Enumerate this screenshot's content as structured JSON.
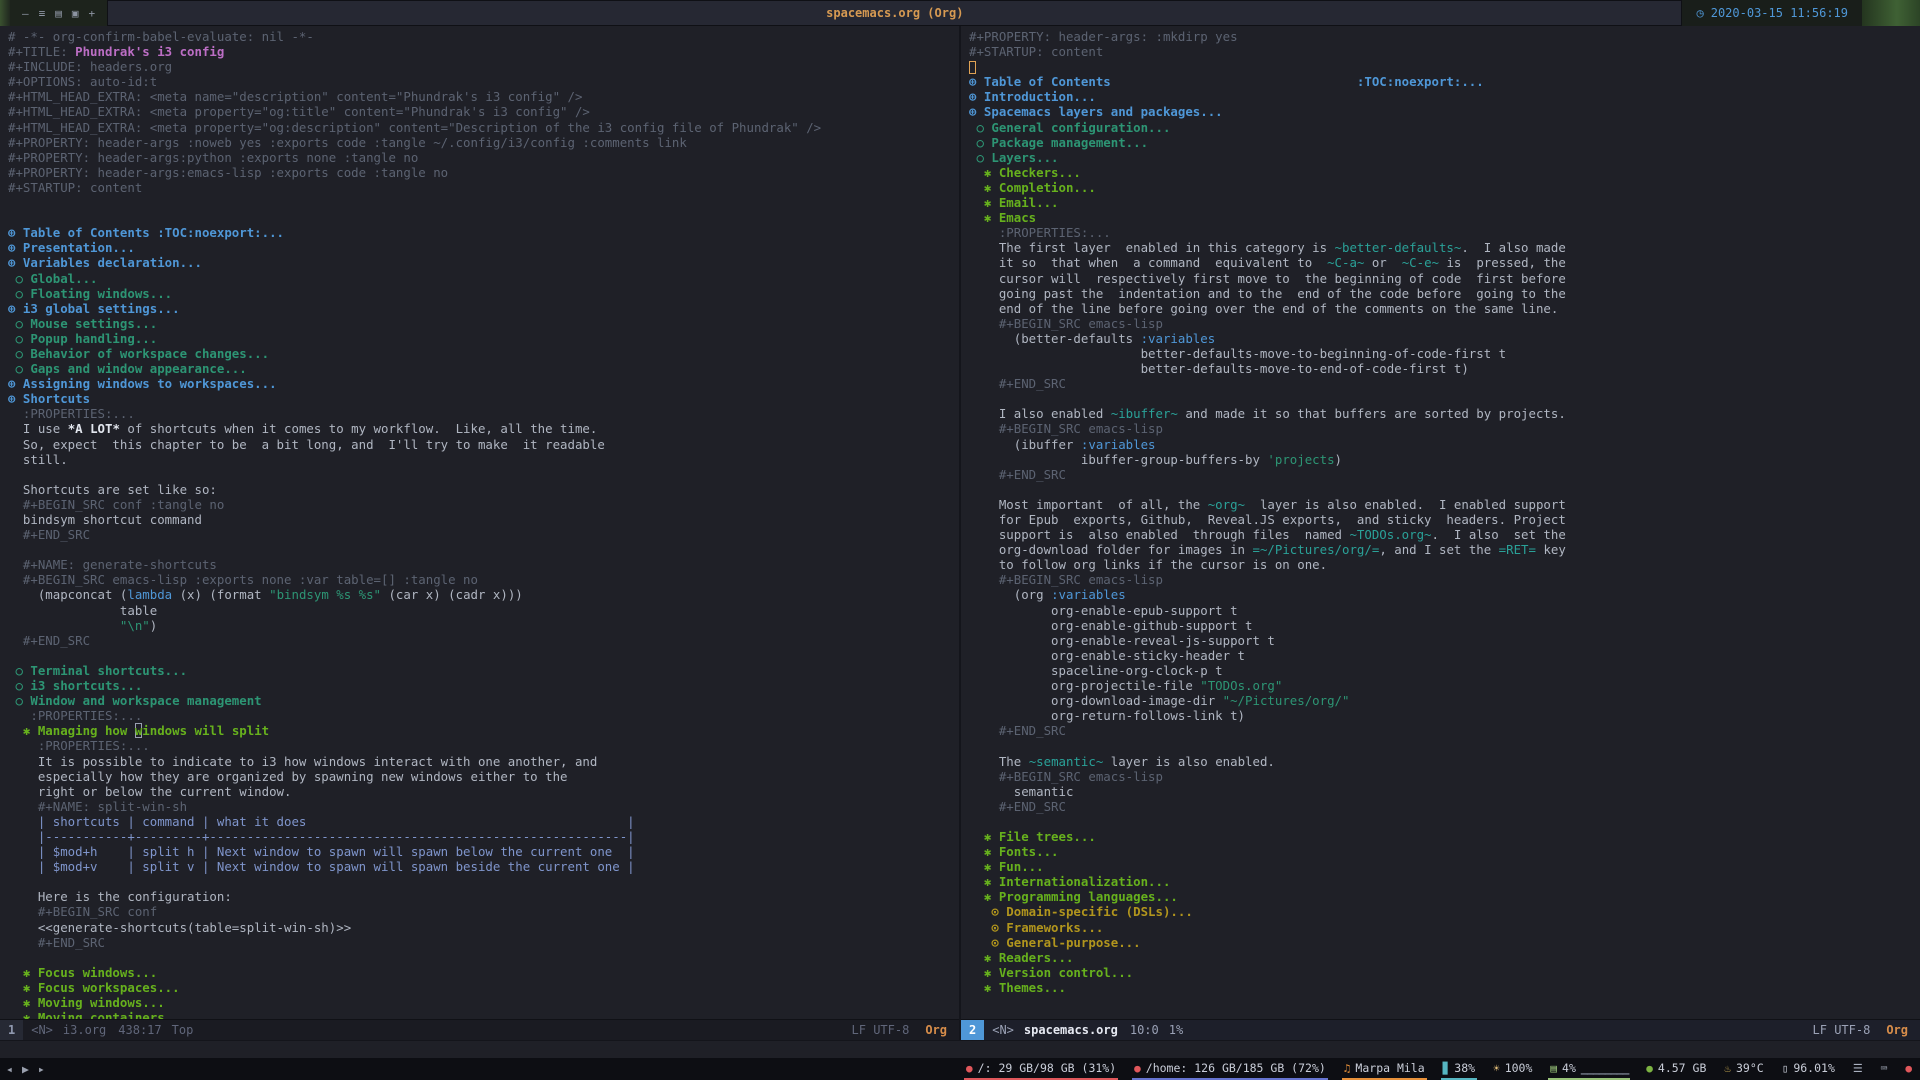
{
  "titlebar": {
    "window_icons": [
      "—",
      "≡",
      "▤",
      "▣",
      "+"
    ],
    "title": "spacemacs.org (Org)",
    "clock_icon": "◷",
    "datetime": "2020-03-15 11:56:19"
  },
  "left_modeline": {
    "win": "1",
    "state": "<N>",
    "buffer": "i3.org",
    "position": "438:17",
    "scroll": "Top",
    "encoding": "LF UTF-8",
    "mode": "Org"
  },
  "right_modeline": {
    "win": "2",
    "state": "<N>",
    "buffer": "spacemacs.org",
    "position": "10:0",
    "scroll": "1%",
    "encoding": "LF UTF-8",
    "mode": "Org"
  },
  "left_buffer": {
    "lines": [
      [
        [
          "c",
          "# -*- org-confirm-babel-evaluate: nil -*-"
        ]
      ],
      [
        [
          "c",
          "#+TITLE: "
        ],
        [
          "t",
          "Phundrak's i3 config"
        ]
      ],
      [
        [
          "c",
          "#+INCLUDE: headers.org"
        ]
      ],
      [
        [
          "c",
          "#+OPTIONS: auto-id:t"
        ]
      ],
      [
        [
          "c",
          "#+HTML_HEAD_EXTRA: <meta name=\"description\" content=\"Phundrak's i3 config\" />"
        ]
      ],
      [
        [
          "c",
          "#+HTML_HEAD_EXTRA: <meta property=\"og:title\" content=\"Phundrak's i3 config\" />"
        ]
      ],
      [
        [
          "c",
          "#+HTML_HEAD_EXTRA: <meta property=\"og:description\" content=\"Description of the i3 config file of Phundrak\" />"
        ]
      ],
      [
        [
          "c",
          "#+PROPERTY: header-args :noweb yes :exports code :tangle ~/.config/i3/config :comments link"
        ]
      ],
      [
        [
          "c",
          "#+PROPERTY: header-args:python :exports none :tangle no"
        ]
      ],
      [
        [
          "c",
          "#+PROPERTY: header-args:emacs-lisp :exports code :tangle no"
        ]
      ],
      [
        [
          "c",
          "#+STARTUP: content"
        ]
      ],
      [],
      [],
      [
        [
          "h1",
          "⊕ Table of Contents :TOC:noexport:..."
        ]
      ],
      [
        [
          "h1",
          "⊕ Presentation..."
        ]
      ],
      [
        [
          "h1",
          "⊕ Variables declaration..."
        ]
      ],
      [
        [
          "h2",
          " ○ Global..."
        ]
      ],
      [
        [
          "h2",
          " ○ Floating windows..."
        ]
      ],
      [
        [
          "h1",
          "⊕ i3 global settings..."
        ]
      ],
      [
        [
          "h2",
          " ○ Mouse settings..."
        ]
      ],
      [
        [
          "h2",
          " ○ Popup handling..."
        ]
      ],
      [
        [
          "h2",
          " ○ Behavior of workspace changes..."
        ]
      ],
      [
        [
          "h2",
          " ○ Gaps and window appearance..."
        ]
      ],
      [
        [
          "h1",
          "⊕ Assigning windows to workspaces..."
        ]
      ],
      [
        [
          "h1",
          "⊕ Shortcuts"
        ]
      ],
      [
        [
          "c",
          "  :PROPERTIES:..."
        ]
      ],
      [
        [
          "d",
          "  I use "
        ],
        [
          "b",
          "*A LOT*"
        ],
        [
          "d",
          " of shortcuts when it comes to my workflow.  Like, all the time."
        ]
      ],
      [
        [
          "d",
          "  So, expect  this chapter to be  a bit long, and  I'll try to make  it readable"
        ]
      ],
      [
        [
          "d",
          "  still."
        ]
      ],
      [],
      [
        [
          "d",
          "  Shortcuts are set like so:"
        ]
      ],
      [
        [
          "c",
          "  #+BEGIN_SRC conf :tangle no"
        ]
      ],
      [
        [
          "d",
          "  bindsym shortcut command"
        ]
      ],
      [
        [
          "c",
          "  #+END_SRC"
        ]
      ],
      [],
      [
        [
          "c",
          "  #+NAME: generate-shortcuts"
        ]
      ],
      [
        [
          "c",
          "  #+BEGIN_SRC emacs-lisp :exports none :var table=[] :tangle no"
        ]
      ],
      [
        [
          "d",
          "    (mapconcat ("
        ],
        [
          "k",
          "lambda"
        ],
        [
          "d",
          " (x) (format "
        ],
        [
          "s",
          "\"bindsym %s %s\""
        ],
        [
          "d",
          " (car x) (cadr x)))"
        ]
      ],
      [
        [
          "d",
          "               table"
        ]
      ],
      [
        [
          "d",
          "               "
        ],
        [
          "s",
          "\"\\n\""
        ],
        [
          "d",
          ")"
        ]
      ],
      [
        [
          "c",
          "  #+END_SRC"
        ]
      ],
      [],
      [
        [
          "h2",
          " ○ Terminal shortcuts..."
        ]
      ],
      [
        [
          "h2",
          " ○ i3 shortcuts..."
        ]
      ],
      [
        [
          "h2",
          " ○ Window and workspace management"
        ]
      ],
      [
        [
          "c",
          "   :PROPERTIES:..."
        ]
      ],
      [
        [
          "h3",
          "  ✱ Managing how "
        ],
        [
          "h3 hl",
          "w"
        ],
        [
          "h3",
          "indows will split"
        ]
      ],
      [
        [
          "c",
          "    :PROPERTIES:..."
        ]
      ],
      [
        [
          "d",
          "    It is possible to indicate to i3 how windows interact with one another, and"
        ]
      ],
      [
        [
          "d",
          "    especially how they are organized by spawning new windows either to the"
        ]
      ],
      [
        [
          "d",
          "    right or below the current window."
        ]
      ],
      [
        [
          "c",
          "    #+NAME: split-win-sh"
        ]
      ],
      [
        [
          "tb",
          "    | shortcuts | command | what it does                                           |"
        ]
      ],
      [
        [
          "tb",
          "    |-----------+---------+--------------------------------------------------------|"
        ]
      ],
      [
        [
          "tb",
          "    | $mod+h    | split h | Next window to spawn will spawn below the current one  |"
        ]
      ],
      [
        [
          "tb",
          "    | $mod+v    | split v | Next window to spawn will spawn beside the current one |"
        ]
      ],
      [],
      [
        [
          "d",
          "    Here is the configuration:"
        ]
      ],
      [
        [
          "c",
          "    #+BEGIN_SRC conf"
        ]
      ],
      [
        [
          "d",
          "    <<generate-shortcuts(table=split-win-sh)>>"
        ]
      ],
      [
        [
          "c",
          "    #+END_SRC"
        ]
      ],
      [],
      [
        [
          "h3",
          "  ✱ Focus windows..."
        ]
      ],
      [
        [
          "h3",
          "  ✱ Focus workspaces..."
        ]
      ],
      [
        [
          "h3",
          "  ✱ Moving windows..."
        ]
      ],
      [
        [
          "h3",
          "  ✱ Moving containers..."
        ]
      ]
    ]
  },
  "right_buffer": {
    "lines": [
      [
        [
          "c",
          "#+PROPERTY: header-args: :mkdirp yes"
        ]
      ],
      [
        [
          "c",
          "#+STARTUP: content"
        ]
      ],
      [
        [
          "cu",
          ""
        ]
      ],
      [
        [
          "h1",
          "⊕ Table of Contents                                 :TOC:noexport:..."
        ]
      ],
      [
        [
          "h1",
          "⊕ Introduction..."
        ]
      ],
      [
        [
          "h1",
          "⊕ Spacemacs layers and packages..."
        ]
      ],
      [
        [
          "h2",
          " ○ General configuration..."
        ]
      ],
      [
        [
          "h2",
          " ○ Package management..."
        ]
      ],
      [
        [
          "h2",
          " ○ Layers..."
        ]
      ],
      [
        [
          "h3",
          "  ✱ Checkers..."
        ]
      ],
      [
        [
          "h3",
          "  ✱ Completion..."
        ]
      ],
      [
        [
          "h3",
          "  ✱ Email..."
        ]
      ],
      [
        [
          "h3",
          "  ✱ Emacs"
        ]
      ],
      [
        [
          "c",
          "    :PROPERTIES:..."
        ]
      ],
      [
        [
          "d",
          "    The first layer  enabled in this category is "
        ],
        [
          "cd",
          "~better-defaults~"
        ],
        [
          "d",
          ".  I also made"
        ]
      ],
      [
        [
          "d",
          "    it so  that when  a command  equivalent to  "
        ],
        [
          "cd",
          "~C-a~"
        ],
        [
          "d",
          " or  "
        ],
        [
          "cd",
          "~C-e~"
        ],
        [
          "d",
          " is  pressed, the"
        ]
      ],
      [
        [
          "d",
          "    cursor will  respectively first move to  the beginning of code  first before"
        ]
      ],
      [
        [
          "d",
          "    going past the  indentation and to the  end of the code before  going to the"
        ]
      ],
      [
        [
          "d",
          "    end of the line before going over the end of the comments on the same line."
        ]
      ],
      [
        [
          "c",
          "    #+BEGIN_SRC emacs-lisp"
        ]
      ],
      [
        [
          "d",
          "      (better-defaults "
        ],
        [
          "k",
          ":variables"
        ]
      ],
      [
        [
          "d",
          "                       better-defaults-move-to-beginning-of-code-first t"
        ]
      ],
      [
        [
          "d",
          "                       better-defaults-move-to-end-of-code-first t)"
        ]
      ],
      [
        [
          "c",
          "    #+END_SRC"
        ]
      ],
      [],
      [
        [
          "d",
          "    I also enabled "
        ],
        [
          "cd",
          "~ibuffer~"
        ],
        [
          "d",
          " and made it so that buffers are sorted by projects."
        ]
      ],
      [
        [
          "c",
          "    #+BEGIN_SRC emacs-lisp"
        ]
      ],
      [
        [
          "d",
          "      (ibuffer "
        ],
        [
          "k",
          ":variables"
        ]
      ],
      [
        [
          "d",
          "               ibuffer-group-buffers-by "
        ],
        [
          "s",
          "'projects"
        ],
        [
          "d",
          ")"
        ]
      ],
      [
        [
          "c",
          "    #+END_SRC"
        ]
      ],
      [],
      [
        [
          "d",
          "    Most important  of all, the "
        ],
        [
          "cd",
          "~org~"
        ],
        [
          "d",
          "  layer is also enabled.  I enabled support"
        ]
      ],
      [
        [
          "d",
          "    for Epub  exports, Github,  Reveal.JS exports,  and sticky  headers. Project"
        ]
      ],
      [
        [
          "d",
          "    support is  also enabled  through files  named "
        ],
        [
          "cd",
          "~TODOs.org~"
        ],
        [
          "d",
          ".  I also  set the"
        ]
      ],
      [
        [
          "d",
          "    org-download folder for images in "
        ],
        [
          "cd",
          "=~/Pictures/org/="
        ],
        [
          "d",
          ", and I set the "
        ],
        [
          "cd",
          "=RET="
        ],
        [
          "d",
          " key"
        ]
      ],
      [
        [
          "d",
          "    to follow org links if the cursor is on one."
        ]
      ],
      [
        [
          "c",
          "    #+BEGIN_SRC emacs-lisp"
        ]
      ],
      [
        [
          "d",
          "      (org "
        ],
        [
          "k",
          ":variables"
        ]
      ],
      [
        [
          "d",
          "           org-enable-epub-support t"
        ]
      ],
      [
        [
          "d",
          "           org-enable-github-support t"
        ]
      ],
      [
        [
          "d",
          "           org-enable-reveal-js-support t"
        ]
      ],
      [
        [
          "d",
          "           org-enable-sticky-header t"
        ]
      ],
      [
        [
          "d",
          "           spaceline-org-clock-p t"
        ]
      ],
      [
        [
          "d",
          "           org-projectile-file "
        ],
        [
          "s",
          "\"TODOs.org\""
        ]
      ],
      [
        [
          "d",
          "           org-download-image-dir "
        ],
        [
          "s",
          "\"~/Pictures/org/\""
        ]
      ],
      [
        [
          "d",
          "           org-return-follows-link t)"
        ]
      ],
      [
        [
          "c",
          "    #+END_SRC"
        ]
      ],
      [],
      [
        [
          "d",
          "    The "
        ],
        [
          "cd",
          "~semantic~"
        ],
        [
          "d",
          " layer is also enabled."
        ]
      ],
      [
        [
          "c",
          "    #+BEGIN_SRC emacs-lisp"
        ]
      ],
      [
        [
          "d",
          "      semantic"
        ]
      ],
      [
        [
          "c",
          "    #+END_SRC"
        ]
      ],
      [],
      [
        [
          "h3",
          "  ✱ File trees..."
        ]
      ],
      [
        [
          "h3",
          "  ✱ Fonts..."
        ]
      ],
      [
        [
          "h3",
          "  ✱ Fun..."
        ]
      ],
      [
        [
          "h3",
          "  ✱ Internationalization..."
        ]
      ],
      [
        [
          "h3",
          "  ✱ Programming languages..."
        ]
      ],
      [
        [
          "h4",
          "   ⊙ Domain-specific (DSLs)..."
        ]
      ],
      [
        [
          "h4",
          "   ⊙ Frameworks..."
        ]
      ],
      [
        [
          "h4",
          "   ⊙ General-purpose..."
        ]
      ],
      [
        [
          "h3",
          "  ✱ Readers..."
        ]
      ],
      [
        [
          "h3",
          "  ✱ Version control..."
        ]
      ],
      [
        [
          "h3",
          "  ✱ Themes..."
        ]
      ]
    ]
  },
  "statusbar": {
    "player_controls": [
      {
        "name": "previous-track-icon",
        "glyph": "◂"
      },
      {
        "name": "play-icon",
        "glyph": "▶"
      },
      {
        "name": "next-track-icon",
        "glyph": "▸"
      }
    ],
    "modules": [
      {
        "name": "disk-root",
        "icon_name": "disk-icon",
        "icon": "●",
        "icon_color": "#e0575b",
        "label": "/: 29 GB/98 GB (31%)",
        "underline": "#e0575b"
      },
      {
        "name": "disk-home",
        "icon_name": "disk-icon",
        "icon": "●",
        "icon_color": "#e0575b",
        "label": "/home: 126 GB/185 GB (72%)",
        "underline": "#6674d0"
      },
      {
        "name": "music-player",
        "icon_name": "music-icon",
        "icon": "♫",
        "icon_color": "#e8913a",
        "label": "Marpa Mila",
        "underline": "#e8913a"
      },
      {
        "name": "volume",
        "icon_name": "volume-icon",
        "icon": "▊",
        "icon_color": "#56b6c2",
        "label": "38%",
        "underline": "#56b6c2"
      },
      {
        "name": "brightness",
        "icon_name": "brightness-icon",
        "icon": "☀",
        "icon_color": "#e5c07b",
        "label": "100%",
        "underline": ""
      },
      {
        "name": "cpu",
        "icon_name": "cpu-icon",
        "icon": "▤",
        "icon_color": "#98c379",
        "label": "4%",
        "graph": "▁▁▁▁▁▁▁▁",
        "underline": "#98c379"
      },
      {
        "name": "memory",
        "icon_name": "memory-icon",
        "icon": "●",
        "icon_color": "#7cb342",
        "label": "4.57 GB",
        "underline": ""
      },
      {
        "name": "temperature",
        "icon_name": "thermometer-icon",
        "icon": "♨",
        "icon_color": "#d6b656",
        "label": "39°C",
        "underline": ""
      },
      {
        "name": "battery",
        "icon_name": "battery-icon",
        "icon": "▯",
        "icon_color": "#ccd1dc",
        "label": "96.01%",
        "underline": ""
      },
      {
        "name": "tray-menu",
        "icon_name": "menu-icon",
        "icon": "☰",
        "icon_color": "#aab1c0",
        "label": "",
        "underline": ""
      },
      {
        "name": "tray-keyboard",
        "icon_name": "keyboard-icon",
        "icon": "⌨",
        "icon_color": "#aab1c0",
        "label": "",
        "underline": ""
      },
      {
        "name": "power",
        "icon_name": "power-icon",
        "icon": "●",
        "icon_color": "#e0575b",
        "label": "",
        "underline": ""
      }
    ]
  }
}
